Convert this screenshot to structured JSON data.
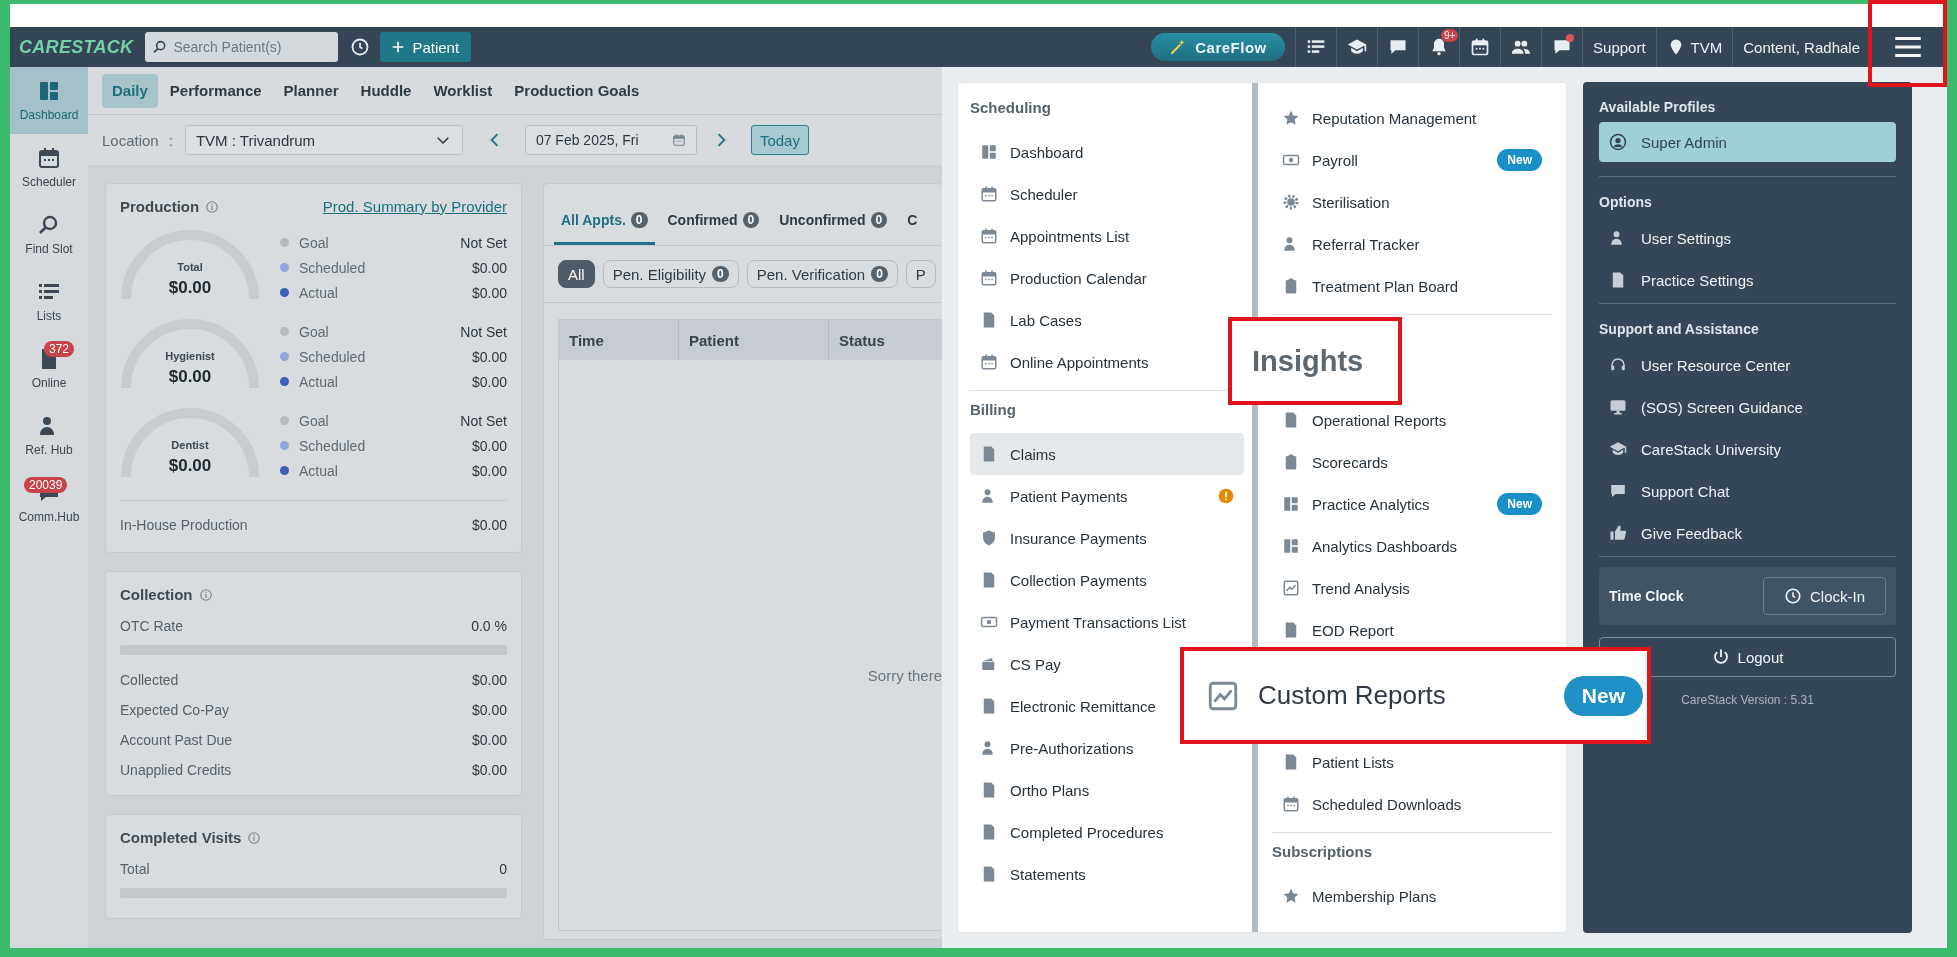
{
  "top_bar": {
    "logo": "CARESTACK",
    "search": {
      "placeholder": "Search Patient(s)"
    },
    "add_patient_button": "Patient",
    "careflow_button": "CareFlow",
    "notification_badge": "9+",
    "unread_messages": true,
    "support_link": "Support",
    "location": "TVM",
    "user_name": "Content, Radhale",
    "menu_button_highlighted": true
  },
  "sidebar": {
    "items": [
      {
        "label": "Dashboard",
        "selected": true
      },
      {
        "label": "Scheduler",
        "selected": false
      },
      {
        "label": "Find Slot",
        "selected": false
      },
      {
        "label": "Lists",
        "selected": false
      },
      {
        "label": "Online",
        "selected": false,
        "badge": "372"
      },
      {
        "label": "Ref. Hub",
        "selected": false
      },
      {
        "label": "Comm.Hub",
        "selected": false,
        "badge": "20039"
      }
    ]
  },
  "tabs": [
    {
      "label": "Daily",
      "selected": true
    },
    {
      "label": "Performance",
      "selected": false
    },
    {
      "label": "Planner",
      "selected": false
    },
    {
      "label": "Huddle",
      "selected": false
    },
    {
      "label": "Worklist",
      "selected": false
    },
    {
      "label": "Production Goals",
      "selected": false
    }
  ],
  "filters": {
    "location_label": "Location",
    "separator": ":",
    "location": "TVM : Trivandrum",
    "date": "07 Feb 2025, Fri",
    "today_button": "Today"
  },
  "production": {
    "title": "Production",
    "link": "Prod. Summary by Provider",
    "gauges": [
      {
        "label": "Total",
        "value": "$0.00",
        "legend": [
          {
            "label": "Goal",
            "value": "Not Set",
            "color": "#b4babf"
          },
          {
            "label": "Scheduled",
            "value": "$0.00",
            "color": "#8fa7dc"
          },
          {
            "label": "Actual",
            "value": "$0.00",
            "color": "#3d5fb5"
          }
        ]
      },
      {
        "label": "Hygienist",
        "value": "$0.00",
        "legend": [
          {
            "label": "Goal",
            "value": "Not Set",
            "color": "#b4babf"
          },
          {
            "label": "Scheduled",
            "value": "$0.00",
            "color": "#8fa7dc"
          },
          {
            "label": "Actual",
            "value": "$0.00",
            "color": "#3d5fb5"
          }
        ]
      },
      {
        "label": "Dentist",
        "value": "$0.00",
        "legend": [
          {
            "label": "Goal",
            "value": "Not Set",
            "color": "#b4babf"
          },
          {
            "label": "Scheduled",
            "value": "$0.00",
            "color": "#8fa7dc"
          },
          {
            "label": "Actual",
            "value": "$0.00",
            "color": "#3d5fb5"
          }
        ]
      }
    ],
    "in_house": {
      "label": "In-House Production",
      "value": "$0.00"
    }
  },
  "collection": {
    "title": "Collection",
    "otc": {
      "label": "OTC Rate",
      "value": "0.0 %",
      "level": 0
    },
    "rows": [
      {
        "label": "Collected",
        "value": "$0.00"
      },
      {
        "label": "Expected Co-Pay",
        "value": "$0.00"
      },
      {
        "label": "Account Past Due",
        "value": "$0.00"
      },
      {
        "label": "Unapplied Credits",
        "value": "$0.00"
      }
    ]
  },
  "completed_visits": {
    "title": "Completed Visits",
    "total": {
      "label": "Total",
      "value": "0",
      "level": 0
    }
  },
  "appointments": {
    "tabs": [
      {
        "label": "All Appts.",
        "count": "0",
        "selected": true
      },
      {
        "label": "Confirmed",
        "count": "0",
        "selected": false
      },
      {
        "label": "Unconfirmed",
        "count": "0",
        "selected": false
      },
      {
        "label": "C",
        "selected": false
      }
    ],
    "filters": [
      {
        "label": "All",
        "selected": true
      },
      {
        "label": "Pen. Eligibility",
        "count": "0",
        "selected": false
      },
      {
        "label": "Pen. Verification",
        "count": "0",
        "selected": false
      },
      {
        "label": "P",
        "selected": false
      }
    ],
    "table": {
      "columns": [
        "Time",
        "Patient",
        "Status"
      ]
    },
    "empty_message": "Sorry there"
  },
  "menu": {
    "columns": [
      {
        "sections": [
          {
            "title": "Scheduling",
            "items": [
              {
                "label": "Dashboard",
                "selected": false
              },
              {
                "label": "Scheduler",
                "selected": false
              },
              {
                "label": "Appointments List",
                "selected": false
              },
              {
                "label": "Production Calendar",
                "selected": false
              },
              {
                "label": "Lab Cases",
                "selected": false
              },
              {
                "label": "Online Appointments",
                "selected": false
              }
            ]
          },
          {
            "title": "Billing",
            "items": [
              {
                "label": "Claims",
                "selected": true,
                "warning": false
              },
              {
                "label": "Patient Payments",
                "selected": false,
                "warning": true
              },
              {
                "label": "Insurance Payments",
                "selected": false,
                "warning": false
              },
              {
                "label": "Collection Payments",
                "selected": false,
                "warning": false
              },
              {
                "label": "Payment Transactions List",
                "selected": false,
                "warning": false
              },
              {
                "label": "CS Pay",
                "selected": false,
                "warning": false
              },
              {
                "label": "Electronic Remittance",
                "selected": false,
                "warning": false
              },
              {
                "label": "Pre-Authorizations",
                "selected": false,
                "warning": false
              },
              {
                "label": "Ortho Plans",
                "selected": false,
                "warning": false
              },
              {
                "label": "Completed Procedures",
                "selected": false,
                "warning": false
              },
              {
                "label": "Statements",
                "selected": false,
                "warning": false
              }
            ]
          }
        ]
      },
      {
        "sections": [
          {
            "items": [
              {
                "label": "Reputation Management",
                "selected": false
              },
              {
                "label": "Payroll",
                "selected": false,
                "badge": "New"
              },
              {
                "label": "Sterilisation",
                "selected": false
              },
              {
                "label": "Referral Tracker",
                "selected": false
              },
              {
                "label": "Treatment Plan Board",
                "selected": false
              }
            ]
          },
          {
            "title": "Insights",
            "magnified": true,
            "items": [
              {
                "label": "Operational Reports",
                "selected": false,
                "magnified": false
              },
              {
                "label": "Scorecards",
                "selected": false,
                "magnified": false
              },
              {
                "label": "Practice Analytics",
                "selected": false,
                "magnified": false,
                "badge": "New"
              },
              {
                "label": "Analytics Dashboards",
                "selected": false,
                "magnified": false
              },
              {
                "label": "Trend Analysis",
                "selected": false,
                "magnified": false
              },
              {
                "label": "EOD Report",
                "selected": false,
                "magnified": false
              },
              {
                "label": "Custom Reports",
                "selected": false,
                "magnified": true,
                "badge": "New"
              },
              {
                "label": "Patient Lists",
                "selected": false,
                "magnified": false
              },
              {
                "label": "Scheduled Downloads",
                "selected": false,
                "magnified": false
              }
            ]
          },
          {
            "title": "Subscriptions",
            "items": [
              {
                "label": "Membership Plans",
                "selected": false
              }
            ]
          }
        ]
      }
    ]
  },
  "account_panel": {
    "profiles_title": "Available Profiles",
    "profiles": [
      {
        "label": "Super Admin",
        "selected": true
      }
    ],
    "sections": [
      {
        "title": "Options",
        "items": [
          "User Settings",
          "Practice Settings"
        ]
      },
      {
        "title": "Support and Assistance",
        "items": [
          "User Resource Center",
          "(SOS) Screen Guidance",
          "CareStack University",
          "Support Chat",
          "Give Feedback"
        ]
      }
    ],
    "time_clock": {
      "label": "Time Clock",
      "button": "Clock-In"
    },
    "logout_button": "Logout",
    "version": "CareStack Version : 5.31"
  }
}
